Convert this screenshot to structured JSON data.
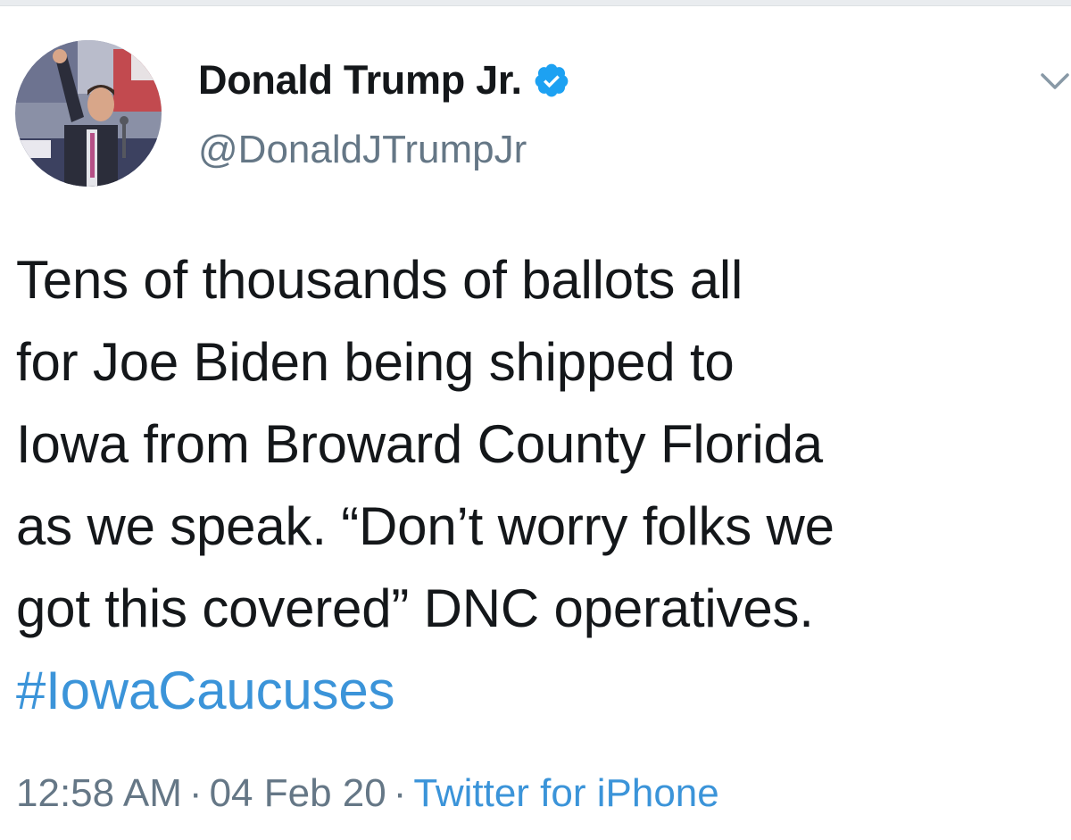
{
  "author": {
    "display_name": "Donald Trump Jr.",
    "handle": "@DonaldJTrumpJr",
    "verified": true,
    "avatar_icon": "profile-photo"
  },
  "tweet": {
    "lines": [
      "Tens of thousands of ballots all",
      "for Joe Biden being shipped to",
      "Iowa from Broward County Florida",
      "as we speak. “Don’t worry folks we",
      "got this covered” DNC operatives."
    ],
    "hashtag": "#IowaCaucuses"
  },
  "meta": {
    "time": "12:58 AM",
    "date": "04 Feb 20",
    "separator": "·",
    "source": "Twitter for iPhone"
  },
  "colors": {
    "link": "#3b94d9",
    "verified": "#1da1f2",
    "secondary_text": "#657786",
    "primary_text": "#14171a"
  },
  "icons": {
    "verified": "verified-badge-icon",
    "menu": "chevron-down-icon"
  }
}
